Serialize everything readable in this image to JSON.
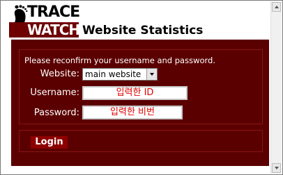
{
  "logo": {
    "line1": "TRACE",
    "line2": "WATCH"
  },
  "page_title": "Website Statistics",
  "form": {
    "instruction": "Please reconfirm your username and password.",
    "website": {
      "label": "Website:",
      "selected": "main website"
    },
    "username": {
      "label": "Username:",
      "value": "입력한 ID"
    },
    "password": {
      "label": "Password:",
      "value": "입력한 비번"
    },
    "login_label": "Login"
  },
  "colors": {
    "panel": "#5b0000",
    "button": "#8e0000",
    "input_text": "#e00000"
  },
  "icons": {
    "logo": "footprint-icon",
    "select": "chevron-down-icon",
    "scroll_up": "scroll-up-arrow-icon",
    "scroll_down": "scroll-down-arrow-icon"
  }
}
